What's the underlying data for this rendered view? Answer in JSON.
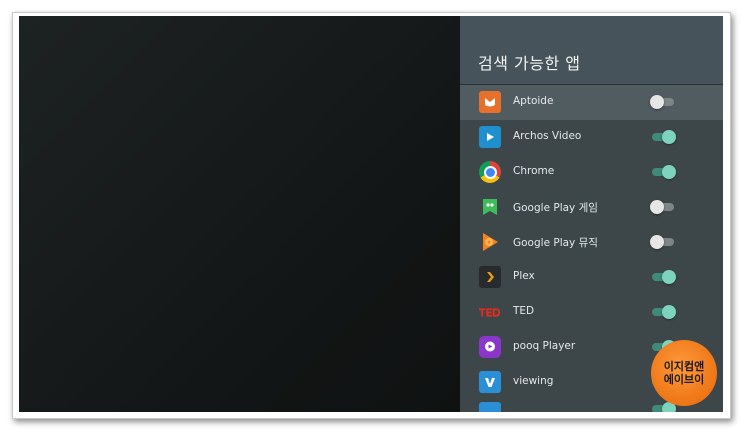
{
  "panel": {
    "title": "검색 가능한 앱"
  },
  "apps": [
    {
      "name": "Aptoide",
      "icon": "aptoide-icon",
      "enabled": false,
      "focused": true
    },
    {
      "name": "Archos Video",
      "icon": "archos-video-icon",
      "enabled": true,
      "focused": false
    },
    {
      "name": "Chrome",
      "icon": "chrome-icon",
      "enabled": true,
      "focused": false
    },
    {
      "name": "Google Play 게임",
      "icon": "google-play-games-icon",
      "enabled": false,
      "focused": false
    },
    {
      "name": "Google Play 뮤직",
      "icon": "google-play-music-icon",
      "enabled": false,
      "focused": false
    },
    {
      "name": "Plex",
      "icon": "plex-icon",
      "enabled": true,
      "focused": false
    },
    {
      "name": "TED",
      "icon": "ted-icon",
      "enabled": true,
      "focused": false
    },
    {
      "name": "pooq Player",
      "icon": "pooq-player-icon",
      "enabled": true,
      "focused": false
    },
    {
      "name": "viewing",
      "icon": "viewing-icon",
      "enabled": true,
      "focused": false
    }
  ],
  "watermark": {
    "line1": "이지컴앤",
    "line2": "에이브이"
  },
  "colors": {
    "toggle_on": "#7ed3be",
    "toggle_off": "#e6e6e6",
    "panel_bg": "#3d474a"
  }
}
